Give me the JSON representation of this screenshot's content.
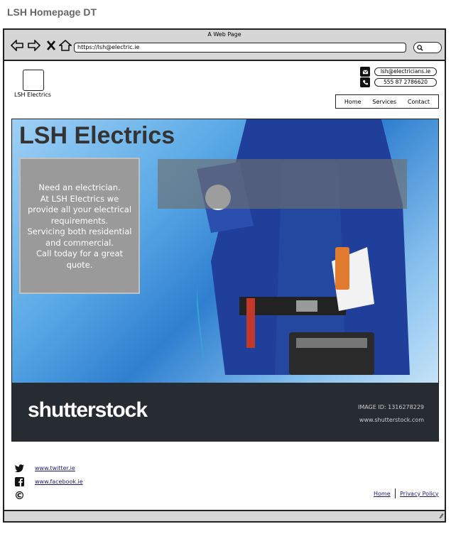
{
  "page": {
    "title": "LSH Homepage DT"
  },
  "browser": {
    "window_title": "A Web Page",
    "url": "https://lsh@electric.ie"
  },
  "site": {
    "logo_label": "LSH Electrics",
    "contact": {
      "email": "lsh@electricians.ie",
      "phone": "555 87 2786620"
    },
    "nav": [
      "Home",
      "Services",
      "Contact"
    ]
  },
  "hero": {
    "heading": "LSH Electrics",
    "text_lines": [
      "Need an electrician.",
      "At LSH Electrics we",
      "provide all your electrical",
      "requirements.",
      "Servicing both residential",
      "and commercial.",
      "Call today for a great quote."
    ],
    "watermark_brand": "shutterstock",
    "watermark_id": "IMAGE ID: 1316278229",
    "watermark_site": "www.shutterstock.com"
  },
  "footer": {
    "social": [
      {
        "icon": "twitter-icon",
        "link": "www.twitter.ie"
      },
      {
        "icon": "facebook-icon",
        "link": "www.facebook.ie"
      }
    ],
    "copyright_symbol": "©",
    "links": [
      "Home",
      "Privacy Policy"
    ]
  }
}
